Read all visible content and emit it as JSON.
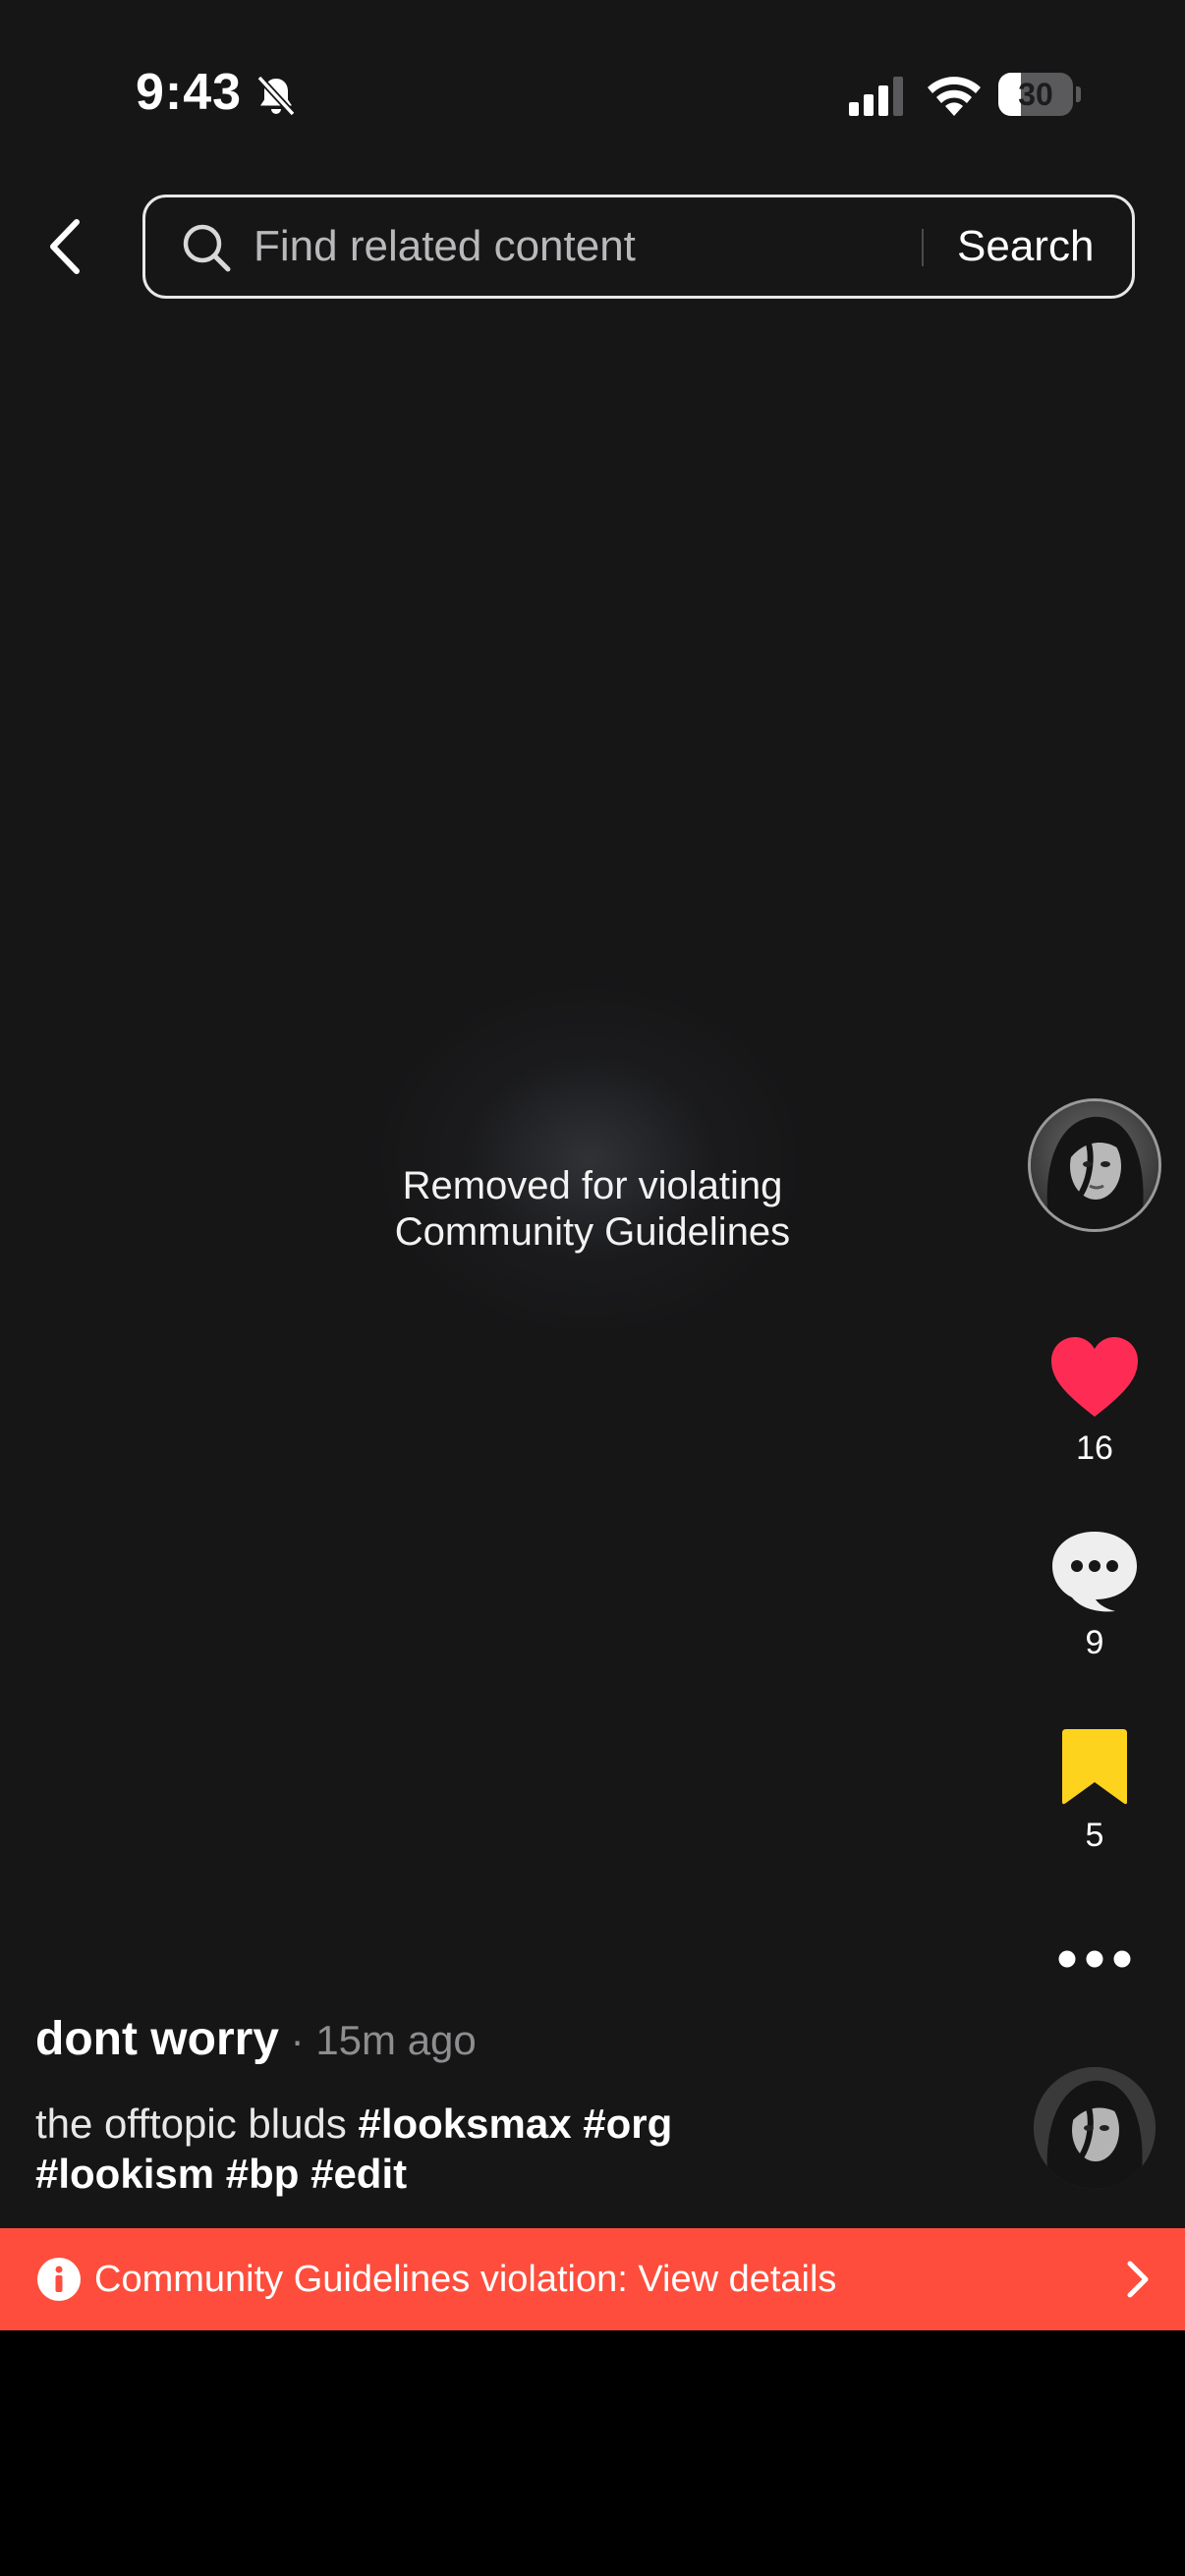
{
  "status_bar": {
    "time": "9:43",
    "battery": "30",
    "battery_level": 0.3,
    "icons": [
      "bell-slash-icon",
      "cellular-signal-icon",
      "wifi-icon",
      "battery-icon"
    ]
  },
  "search": {
    "placeholder": "Find related content",
    "button_label": "Search",
    "icons": [
      "back-arrow-icon",
      "search-icon"
    ]
  },
  "video": {
    "removed_line1": "Removed for violating",
    "removed_line2": "Community Guidelines"
  },
  "actions": {
    "likes": "16",
    "comments": "9",
    "saves": "5",
    "icons": [
      "heart-icon",
      "comment-bubble-icon",
      "bookmark-icon",
      "more-dots-icon"
    ]
  },
  "post": {
    "author": "dont worry",
    "time": "15m ago",
    "caption_text": "the offtopic bluds",
    "hashtags": [
      "#looksmax",
      "#org",
      "#lookism",
      "#bp",
      "#edit"
    ]
  },
  "banner": {
    "text": "Community Guidelines violation: View details"
  },
  "colors": {
    "background": "#161617",
    "accent_like": "#fe2c55",
    "accent_save": "#fdd31d",
    "banner": "#fe4d3c"
  }
}
